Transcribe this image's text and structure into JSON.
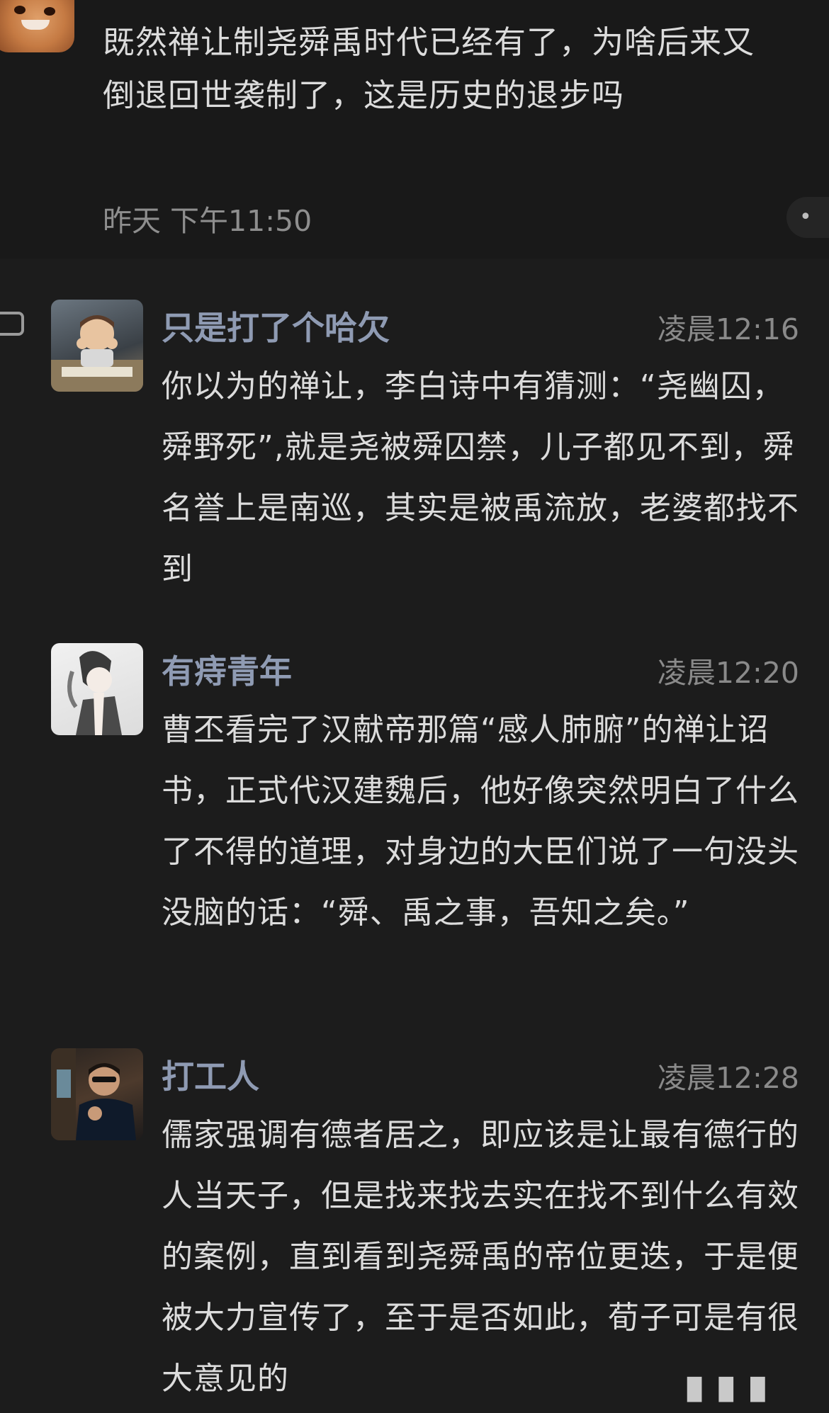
{
  "post": {
    "text": "既然禅让制尧舜禹时代已经有了，为啥后来又倒退回世袭制了，这是历史的退步吗",
    "time": "昨天 下午11:50",
    "more_label": "•"
  },
  "comments": [
    {
      "name": "只是打了个哈欠",
      "time": "凌晨12:16",
      "text": "你以为的禅让，李白诗中有猜测：“尧幽囚，舜野死”,就是尧被舜囚禁，儿子都见不到，舜名誉上是南巡，其实是被禹流放，老婆都找不到"
    },
    {
      "name": "有痔青年",
      "time": "凌晨12:20",
      "text": "曹丕看完了汉献帝那篇“感人肺腑”的禅让诏书，正式代汉建魏后，他好像突然明白了什么了不得的道理，对身边的大臣们说了一句没头没脑的话：“舜、禹之事，吾知之矣。”"
    },
    {
      "name": "打工人",
      "time": "凌晨12:28",
      "text": "儒家强调有德者居之，即应该是让最有德行的人当天子，但是找来找去实在找不到什么有效的案例，直到看到尧舜禹的帝位更迭，于是便被大力宣传了，至于是否如此，荀子可是有很大意见的"
    }
  ],
  "icons": {
    "side": "comment-icon",
    "more": "more-dots-icon"
  },
  "colors": {
    "background": "#1c1c1c",
    "text": "#dcdcdc",
    "username": "#8f9bb3",
    "timestamp": "#8a8a8a"
  }
}
